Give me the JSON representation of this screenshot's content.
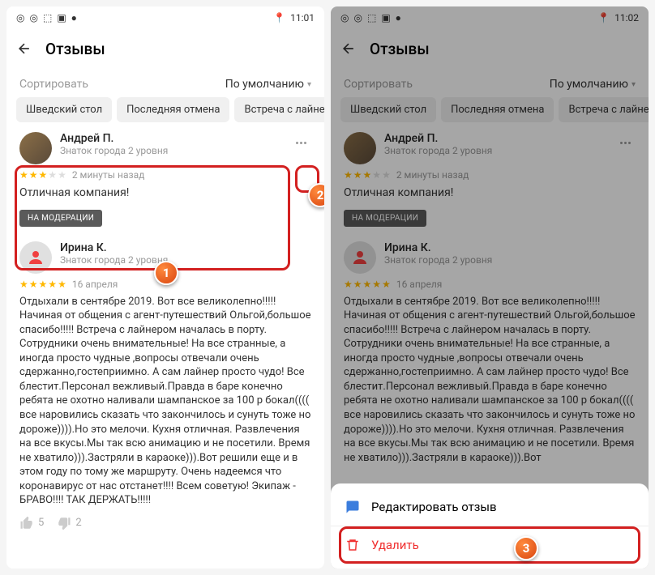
{
  "status": {
    "time_left": "11:01",
    "time_right": "11:02"
  },
  "header": {
    "title": "Отзывы"
  },
  "sort": {
    "label": "Сортировать",
    "value": "По умолчанию"
  },
  "tags": [
    "Шведский стол",
    "Последняя отмена",
    "Встреча с лайнером"
  ],
  "reviews": [
    {
      "name": "Андрей П.",
      "sub": "Знаток города 2 уровня",
      "stars": 3,
      "time": "2 минуты назад",
      "text": "Отличная компания!",
      "badge": "НА МОДЕРАЦИИ"
    },
    {
      "name": "Ирина К.",
      "sub": "Знаток города 2 уровня",
      "stars": 5,
      "time": "16 апреля",
      "text": "Отдыхали в сентябре 2019. Вот все великолепно!!!!! Начиная от общения с агент-путешествий Ольгой,большое спасибо!!!!! Встреча с лайнером началась в порту. Сотрудники очень внимательные! На все странные, а иногда просто чудные ,вопросы отвечали очень сдержанно,гостеприимно. А сам лайнер просто чудо! Все блестит.Персонал вежливый.Правда в баре конечно ребята не охотно наливали шампанское за 100 р бокал(((( все наровились  сказать  что закончилось и сунуть  тоже но дороже)))).Но это мелочи. Кухня отличная. Развлечения на все вкусы.Мы так всю анимацию и не посетили. Время не хватило))).Застряли в караоке))).Вот решили еще и в этом году по тому же маршруту. Очень надеемся что коронавирус от нас отстанет!!!! Всем советую! Экипаж - БРАВО!!!! ТАК ДЕРЖАТЬ!!!!!",
      "text_cut": "Отдыхали в сентябре 2019. Вот все великолепно!!!!! Начиная от общения с агент-путешествий Ольгой,большое спасибо!!!!! Встреча с лайнером началась в порту. Сотрудники очень внимательные! На все странные, а иногда просто чудные ,вопросы отвечали очень сдержанно,гостеприимно. А сам лайнер просто чудо! Все блестит.Персонал вежливый.Правда в баре конечно ребята не охотно наливали шампанское за 100 р бокал(((( все наровились  сказать  что закончилось и сунуть  тоже но дороже)))).Но это мелочи. Кухня отличная. Развлечения на все вкусы.Мы так всю анимацию и не посетили. Время не хватило))).Застряли в караоке))).Вот"
    }
  ],
  "reactions": {
    "up": "5",
    "down": "2"
  },
  "menu": {
    "edit": "Редактировать отзыв",
    "delete": "Удалить"
  },
  "callouts": {
    "c1": "1",
    "c2": "2",
    "c3": "3"
  }
}
